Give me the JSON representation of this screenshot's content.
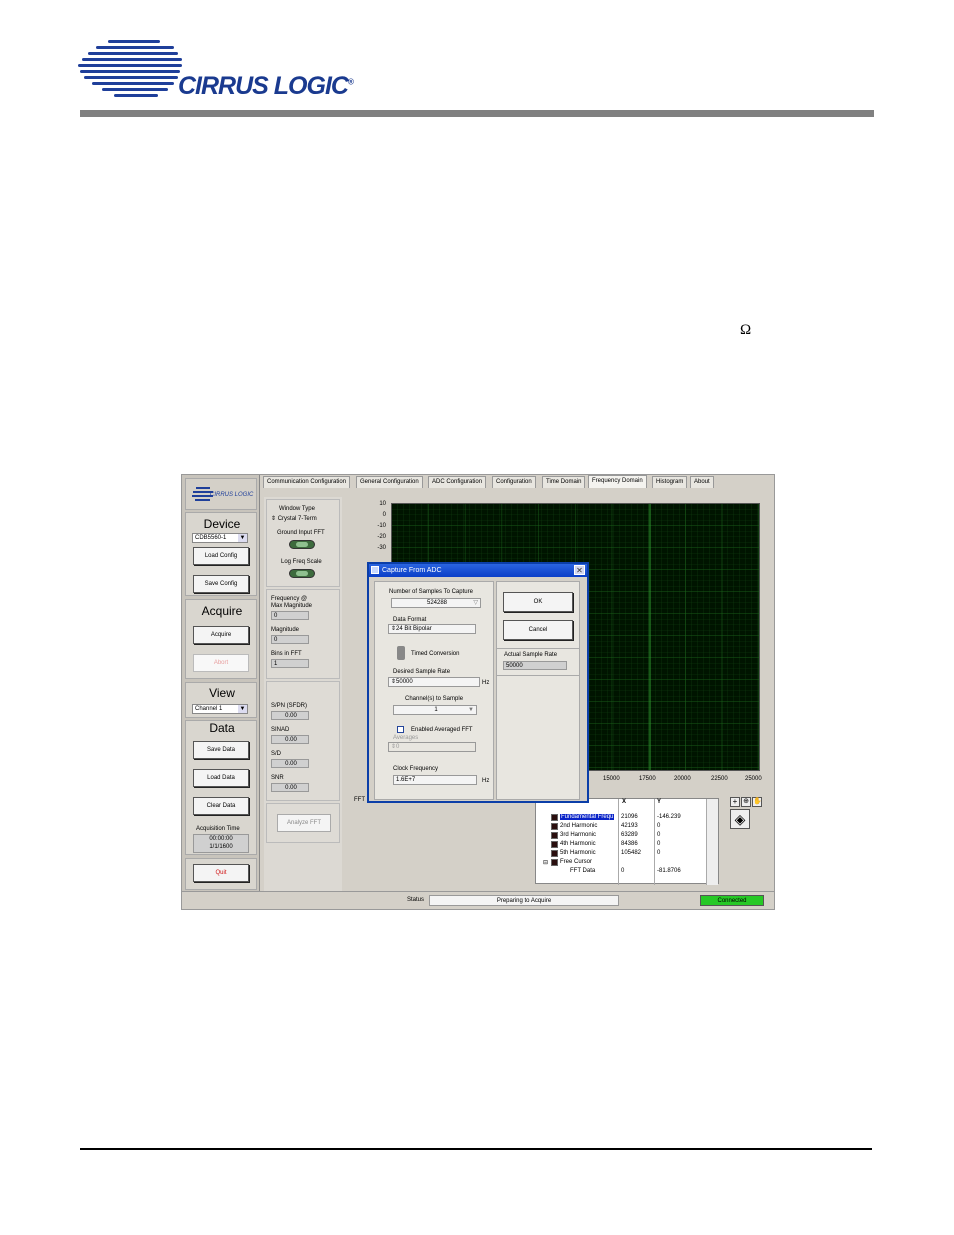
{
  "document": {
    "brand": "CIRRUS LOGIC",
    "registered_mark": "®",
    "omega_symbol": "Ω"
  },
  "app": {
    "logo_text": "CIRRUS LOGIC",
    "sections": {
      "device_title": "Device",
      "device_select": "CDB5560-1",
      "load_config": "Load Config",
      "save_config": "Save Config",
      "acquire_title": "Acquire",
      "acquire_button": "Acquire",
      "abort_button": "Abort",
      "view_title": "View",
      "view_select": "Channel 1",
      "data_title": "Data",
      "save_data": "Save Data",
      "load_data": "Load Data",
      "clear_data": "Clear Data",
      "acq_time_label": "Acquisition Time",
      "acq_time_value1": "00:00:00",
      "acq_time_value2": "1/1/1600",
      "quit_button": "Quit"
    },
    "tabs": [
      {
        "label": "Communication Configuration"
      },
      {
        "label": "General Configuration"
      },
      {
        "label": "ADC Configuration"
      },
      {
        "label": "Configuration"
      },
      {
        "label": "Time Domain"
      },
      {
        "label": "Frequency Domain"
      },
      {
        "label": "Histogram"
      },
      {
        "label": "About"
      }
    ],
    "active_tab": "Frequency Domain",
    "fft_panel": {
      "window_type_label": "Window Type",
      "window_type_value": "Crystal 7-Term",
      "ground_input_label": "Ground Input FFT",
      "log_freq_label": "Log Freq Scale",
      "freq_label": "Frequency @",
      "max_mag_label": "Max Magnitude",
      "freq_value": "0",
      "magnitude_label": "Magnitude",
      "magnitude_value": "0",
      "bins_label": "Bins in FFT",
      "bins_value": "1",
      "s_pn_label": "S/PN (SFDR)",
      "s_pn_value": "0.00",
      "sinad_label": "SINAD",
      "sinad_value": "0.00",
      "s_d_label": "S/D",
      "s_d_value": "0.00",
      "snr_label": "SNR",
      "snr_value": "0.00",
      "analyze_button": "Analyze FFT"
    },
    "plot": {
      "y_ticks": [
        "10",
        "0",
        "-10",
        "-20",
        "-30"
      ],
      "x_ticks": [
        "15000",
        "17500",
        "20000",
        "22500",
        "25000"
      ],
      "bottom_label": "FFT"
    },
    "dialog": {
      "title": "Capture From ADC",
      "samples_label": "Number of Samples To Capture",
      "samples_value": "524288",
      "data_format_label": "Data Format",
      "data_format_value": "24 Bit  Bipolar",
      "timed_conversion_label": "Timed Conversion",
      "desired_rate_label": "Desired Sample Rate",
      "desired_rate_value": "50000",
      "hz1": "Hz",
      "channels_label": "Channel(s) to Sample",
      "channels_value": "1",
      "averaged_label": "Enabled Averaged FFT",
      "averages_label": "Averages",
      "averages_value": "0",
      "clock_label": "Clock Frequency",
      "clock_value": "1.6E+7",
      "hz2": "Hz",
      "ok": "OK",
      "cancel": "Cancel",
      "actual_rate_label": "Actual Sample Rate",
      "actual_rate_value": "50000"
    },
    "cursor_table": {
      "col_x": "X",
      "col_y": "Y",
      "rows": [
        {
          "name": "Fundamental Frequ",
          "x": "21096",
          "y": "-146.239"
        },
        {
          "name": "2nd Harmonic",
          "x": "42193",
          "y": "0"
        },
        {
          "name": "3rd Harmonic",
          "x": "63289",
          "y": "0"
        },
        {
          "name": "4th Harmonic",
          "x": "84386",
          "y": "0"
        },
        {
          "name": "5th Harmonic",
          "x": "105482",
          "y": "0"
        },
        {
          "name": "Free Cursor",
          "x": "",
          "y": ""
        },
        {
          "name": "FFT Data",
          "x": "0",
          "y": "-81.8706"
        }
      ]
    },
    "status": {
      "label": "Status",
      "value": "Preparing to Acquire",
      "connection": "Connected"
    }
  }
}
